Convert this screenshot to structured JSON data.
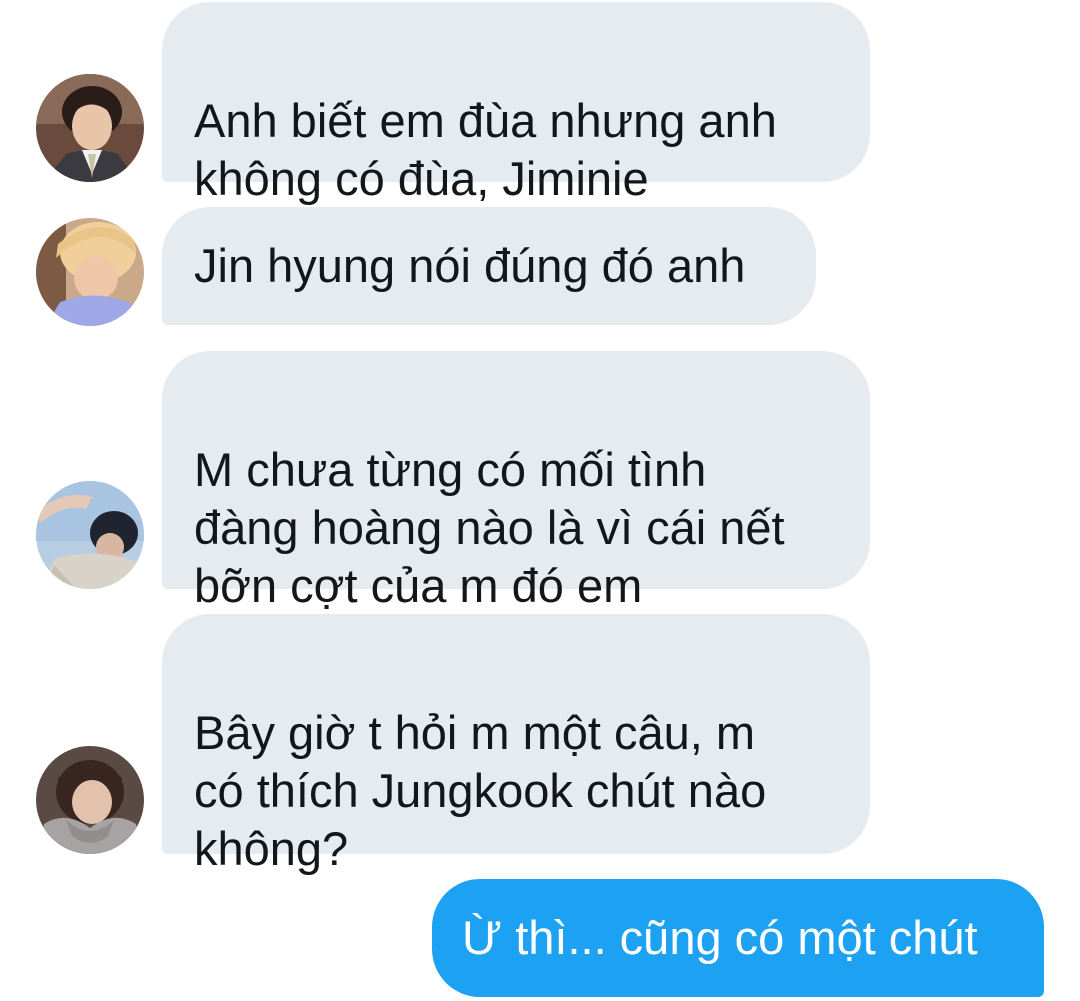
{
  "conversation": {
    "messages": [
      {
        "direction": "incoming",
        "avatar": "avatar-jin",
        "text": "Anh biết em đùa nhưng anh\nkhông có đùa, Jiminie"
      },
      {
        "direction": "incoming",
        "avatar": "avatar-blonde",
        "text": "Jin hyung nói đúng đó anh"
      },
      {
        "direction": "incoming",
        "avatar": "avatar-sky",
        "text": "M chưa từng có mối tình\nđàng hoàng nào là vì cái nết\nbỡn cợt của m đó em"
      },
      {
        "direction": "incoming",
        "avatar": "avatar-hoodie",
        "text": "Bây giờ t hỏi m một câu, m\ncó thích Jungkook chút nào\nkhông?"
      },
      {
        "direction": "outgoing",
        "text": "Ừ thì... cũng có một chút"
      }
    ]
  },
  "colors": {
    "incoming_bubble": "#e6ebef",
    "outgoing_bubble": "#1da1f2",
    "incoming_text": "#14171a",
    "outgoing_text": "#ffffff"
  }
}
